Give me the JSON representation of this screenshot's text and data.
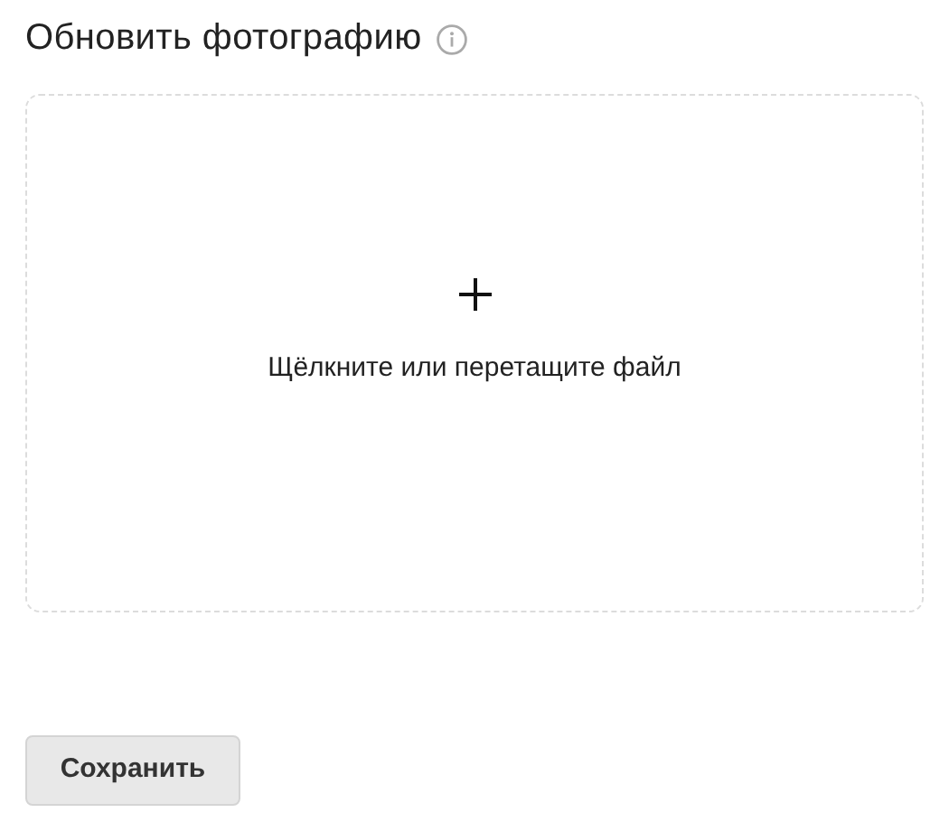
{
  "title": "Обновить фотографию",
  "dropzone": {
    "hint": "Щёлкните или перетащите файл"
  },
  "buttons": [
    "Сохранить"
  ]
}
